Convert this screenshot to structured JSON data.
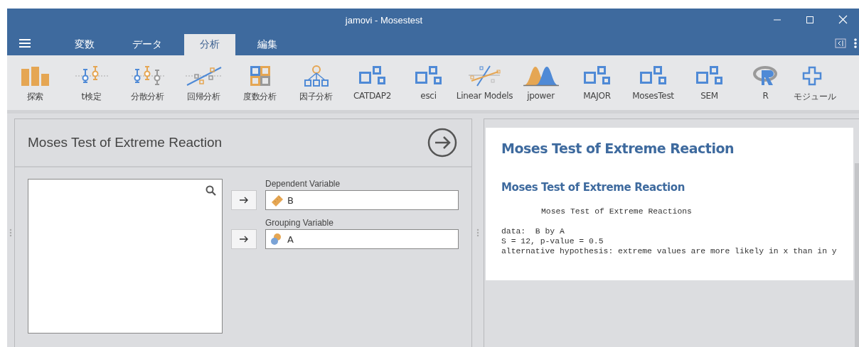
{
  "window": {
    "title": "jamovi - Mosestest"
  },
  "tabs": [
    {
      "label": "変数",
      "selected": false
    },
    {
      "label": "データ",
      "selected": false
    },
    {
      "label": "分析",
      "selected": true
    },
    {
      "label": "編集",
      "selected": false
    }
  ],
  "ribbon": [
    {
      "label": "探索",
      "kind": "bars"
    },
    {
      "label": "t検定",
      "kind": "ttest"
    },
    {
      "label": "分散分析",
      "kind": "anova"
    },
    {
      "label": "回帰分析",
      "kind": "regression"
    },
    {
      "label": "度数分析",
      "kind": "frequency"
    },
    {
      "label": "因子分析",
      "kind": "factor"
    },
    {
      "label": "CATDAP2",
      "kind": "module"
    },
    {
      "label": "esci",
      "kind": "module"
    },
    {
      "label": "Linear Models",
      "kind": "linear"
    },
    {
      "label": "jpower",
      "kind": "power"
    },
    {
      "label": "MAJOR",
      "kind": "module"
    },
    {
      "label": "MosesTest",
      "kind": "module"
    },
    {
      "label": "SEM",
      "kind": "module"
    },
    {
      "label": "R",
      "kind": "r"
    },
    {
      "label": "モジュール",
      "kind": "plus"
    }
  ],
  "options": {
    "title": "Moses Test of Extreme Reaction",
    "targets": [
      {
        "label": "Dependent Variable",
        "variable": "B",
        "kind": "continuous"
      },
      {
        "label": "Grouping Variable",
        "variable": "A",
        "kind": "nominal"
      }
    ]
  },
  "results": {
    "title": "Moses Test of Extreme Reaction",
    "subtitle": "Moses Test of Extreme Reaction",
    "output_heading": "Moses Test of Extreme Reactions",
    "output_lines": [
      "data:  B by A",
      "S = 12, p-value = 0.5",
      "alternative hypothesis: extreme values are more likely in x than in y"
    ]
  }
}
